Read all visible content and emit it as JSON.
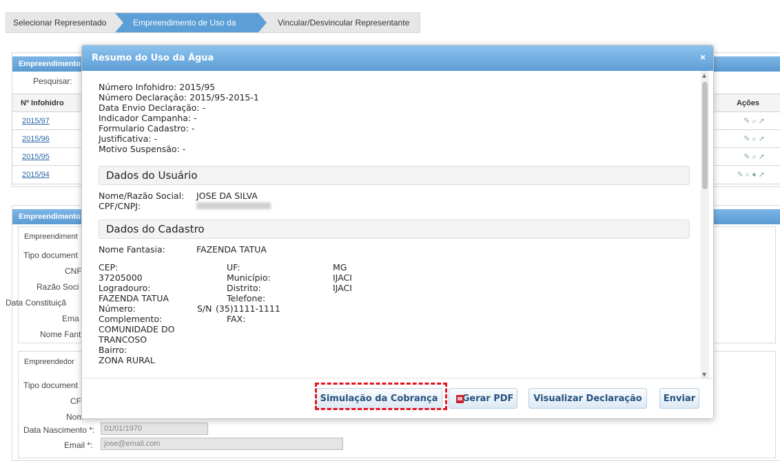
{
  "tabs": [
    {
      "label": "Selecionar Representado"
    },
    {
      "label": "Empreendimento de Uso da Água"
    },
    {
      "label": "Vincular/Desvincular Representante"
    }
  ],
  "background": {
    "panel1_head": "Empreendimento",
    "search_label": "Pesquisar:",
    "table_header_code": "Nº Infohidro",
    "table_header_actions": "Ações",
    "rows": [
      "2015/97",
      "2015/96",
      "2015/95",
      "2015/94"
    ],
    "panel2_head": "Empreendimento",
    "sub1_head": "Empreendiment",
    "labels": [
      "Tipo document",
      "CNF",
      "Razão Soci",
      "Data Constituiçã",
      "Ema",
      "Nome Fant"
    ],
    "sub2_head": "Empreendedor",
    "labels2": [
      "Tipo document",
      "CF",
      "Nom"
    ],
    "data_nascimento_label": "Data Nascimento *:",
    "data_nascimento_value": "01/01/1970",
    "email_label": "Email *:",
    "email_value": "jose@email.com"
  },
  "modal": {
    "title": "Resumo do Uso da Água",
    "close": "×",
    "info": [
      "Número Infohidro: 2015/95",
      "Número Declaração: 2015/95-2015-1",
      "Data Envio Declaração: -",
      "Indicador Campanha: -",
      "Formulario Cadastro: -",
      "Justificativa: -",
      "Motivo Suspensão: -"
    ],
    "usuario": {
      "section": "Dados do Usuário",
      "nome_label": "Nome/Razão Social:",
      "nome_value": "JOSE DA SILVA",
      "cpf_label": "CPF/CNPJ:"
    },
    "cadastro": {
      "section": "Dados do Cadastro",
      "fantasia_label": "Nome Fantasia:",
      "fantasia_value": "FAZENDA TATUA",
      "col1": [
        "CEP:",
        "37205000",
        "Logradouro:",
        "FAZENDA TATUA",
        "Número:",
        "Complemento:",
        "COMUNIDADE DO",
        "TRANCOSO",
        "Bairro:",
        "ZONA RURAL"
      ],
      "numero_value": "S/N",
      "col2": [
        "UF:",
        "Município:",
        "Distrito:",
        "Telefone:",
        "(35)1111-1111",
        "FAX:"
      ],
      "col3": [
        "MG",
        "IJACI",
        "IJACI"
      ]
    },
    "buttons": {
      "simulacao": "Simulação da Cobrança",
      "pdf": "Gerar PDF",
      "visualizar": "Visualizar Declaração",
      "enviar": "Enviar"
    }
  }
}
